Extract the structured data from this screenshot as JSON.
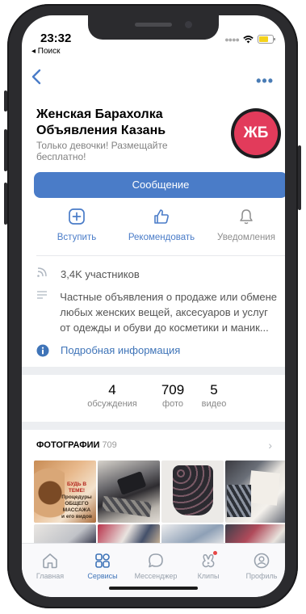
{
  "status": {
    "time": "23:32",
    "back_app": "◂ Поиск"
  },
  "group": {
    "title_line1": "Женская Барахолка",
    "title_line2": "Объявления Казань",
    "subtitle": "Только девочки! Размещайте бесплатно!",
    "avatar_text": "ЖБ",
    "message_button": "Сообщение"
  },
  "actions": [
    {
      "label": "Вступить",
      "icon": "plus-square-icon"
    },
    {
      "label": "Рекомендовать",
      "icon": "thumbs-up-icon"
    },
    {
      "label": "Уведомления",
      "icon": "bell-icon"
    }
  ],
  "info": {
    "members": "3,4K участников",
    "description": "Частные объявления о продаже или обмене любых женских вещей, аксесуаров и услуг от одежды и обуви до косметики и маник...",
    "details_link": "Подробная информация"
  },
  "counters": [
    {
      "value": "4",
      "label": "обсуждения"
    },
    {
      "value": "709",
      "label": "фото"
    },
    {
      "value": "5",
      "label": "видео"
    }
  ],
  "photos": {
    "title": "ФОТОГРАФИИ",
    "count": "709",
    "promo_lines": [
      "БУДЬ В ТЕМЕ!",
      "Процедуры",
      "ОБЩЕГО МАССАЖА",
      "и его видов"
    ]
  },
  "tabs": [
    {
      "label": "Главная",
      "icon": "home-icon"
    },
    {
      "label": "Сервисы",
      "icon": "services-grid-icon"
    },
    {
      "label": "Мессенджер",
      "icon": "chat-bubble-icon"
    },
    {
      "label": "Клипы",
      "icon": "clips-icon"
    },
    {
      "label": "Профиль",
      "icon": "profile-icon"
    }
  ],
  "colors": {
    "accent": "#4a7cc8",
    "avatar": "#e23b5b",
    "link": "#3f74b8"
  }
}
